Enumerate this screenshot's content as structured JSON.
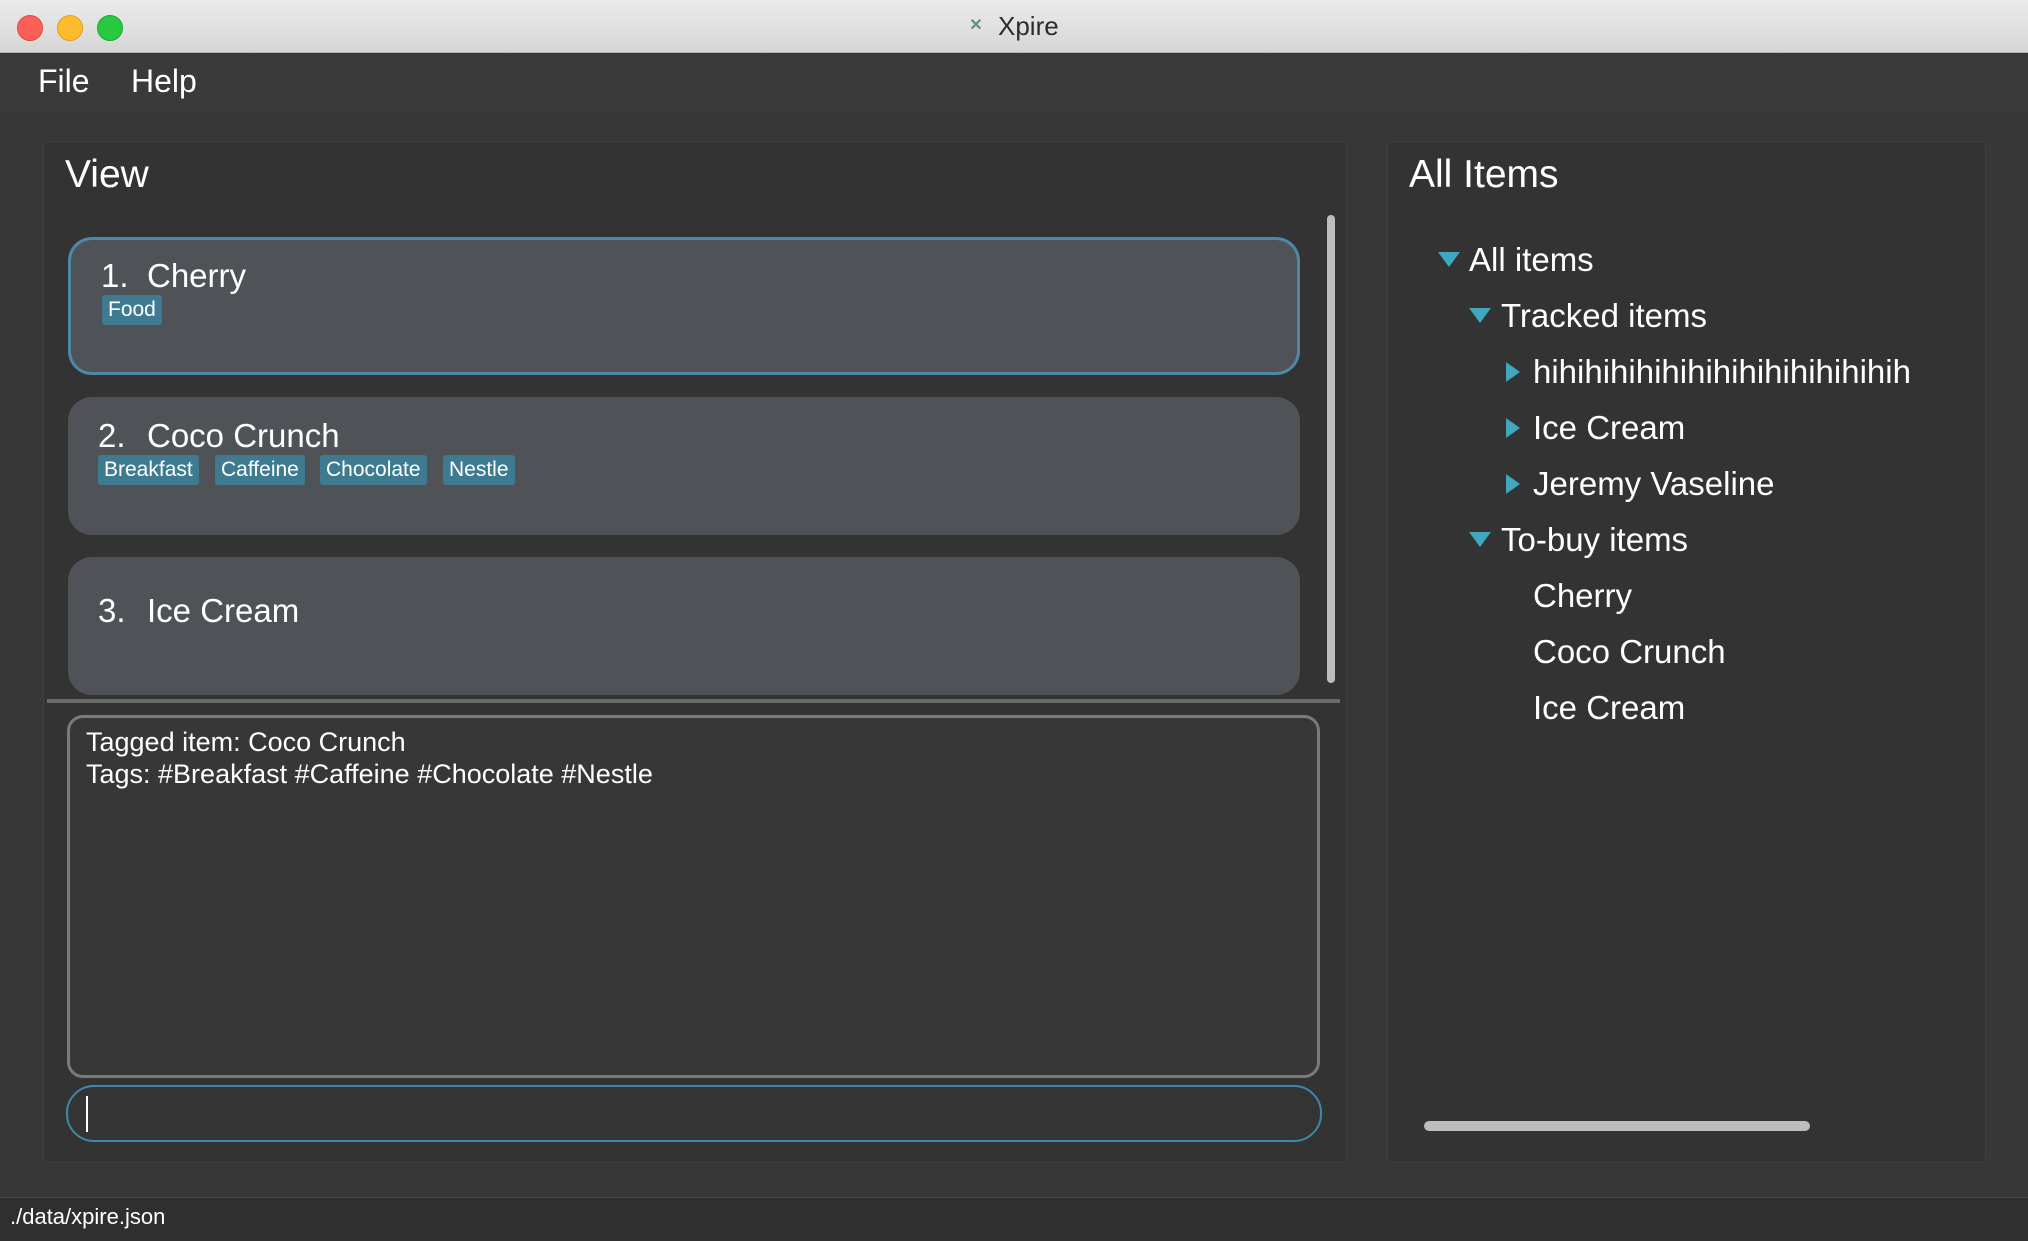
{
  "window": {
    "title": "Xpire",
    "app_icon": "Xpire logo"
  },
  "menu": {
    "file": "File",
    "help": "Help"
  },
  "view_panel": {
    "title": "View",
    "items": [
      {
        "index": "1.",
        "name": "Cherry",
        "tags": [
          "Food"
        ]
      },
      {
        "index": "2.",
        "name": "Coco Crunch",
        "tags": [
          "Breakfast",
          "Caffeine",
          "Chocolate",
          "Nestle"
        ]
      },
      {
        "index": "3.",
        "name": "Ice Cream",
        "tags": []
      }
    ]
  },
  "result_display": {
    "line1": "Tagged item: Coco Crunch",
    "line2": "Tags: #Breakfast #Caffeine #Chocolate #Nestle"
  },
  "command_box": {
    "value": "",
    "placeholder": ""
  },
  "all_items_panel": {
    "title": "All Items",
    "root": "All items",
    "tracked": {
      "label": "Tracked items",
      "children": [
        "hihihihihihihihihihihihihihih",
        "Ice Cream",
        "Jeremy Vaseline"
      ]
    },
    "to_buy": {
      "label": "To-buy items",
      "children": [
        "Cherry",
        "Coco Crunch",
        "Ice Cream"
      ]
    }
  },
  "status_bar": {
    "path": "./data/xpire.json"
  },
  "colors": {
    "background": "#373737",
    "card": "#4f5357",
    "tag": "#3e7b91",
    "accent": "#3fa7be",
    "selected_border": "#4e88a6"
  }
}
